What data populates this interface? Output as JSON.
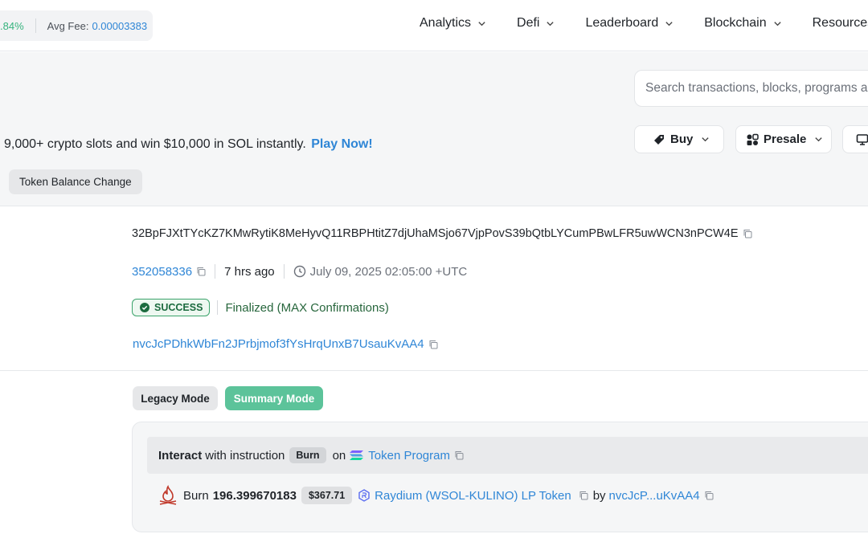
{
  "stats": {
    "change_pct": ".84%",
    "fee_label": "Avg Fee:",
    "fee_value": "0.00003383"
  },
  "nav": [
    {
      "label": "Analytics"
    },
    {
      "label": "Defi"
    },
    {
      "label": "Leaderboard"
    },
    {
      "label": "Blockchain"
    },
    {
      "label": "Resources"
    }
  ],
  "search": {
    "placeholder": "Search transactions, blocks, programs and tokens"
  },
  "promo": {
    "text": "9,000+ crypto slots and win $10,000 in SOL instantly.",
    "link": "Play Now!"
  },
  "actions": {
    "buy": "Buy",
    "presale": "Presale"
  },
  "tabs": {
    "token_balance_change": "Token Balance Change"
  },
  "tx": {
    "signature": "32BpFJXtTYcKZ7KMwRytiK8MeHyvQ11RBPHtitZ7djUhaMSjo67VjpPovS39bQtbLYCumPBwLFR5uwWCN3nPCW4E",
    "slot": "352058336",
    "ago": "7 hrs ago",
    "timestamp": "July 09, 2025 02:05:00 +UTC",
    "status": "SUCCESS",
    "confirmation": "Finalized (MAX Confirmations)",
    "signer": "nvcJcPDhkWbFn2JPrbjmof3fYsHrqUnxB7UsauKvAA4"
  },
  "modes": {
    "legacy": "Legacy Mode",
    "summary": "Summary Mode"
  },
  "instruction": {
    "interact": "Interact",
    "with_text": "with instruction",
    "name": "Burn",
    "on_text": "on",
    "program": "Token Program",
    "action": "Burn",
    "amount": "196.399670183",
    "usd": "$367.71",
    "token": "Raydium (WSOL-KULINO) LP Token",
    "by_text": "by",
    "account": "nvcJcP...uKvAA4"
  },
  "colors": {
    "accent": "#2f86d6",
    "success": "#3aa36a",
    "summary_button": "#5cc39a"
  }
}
